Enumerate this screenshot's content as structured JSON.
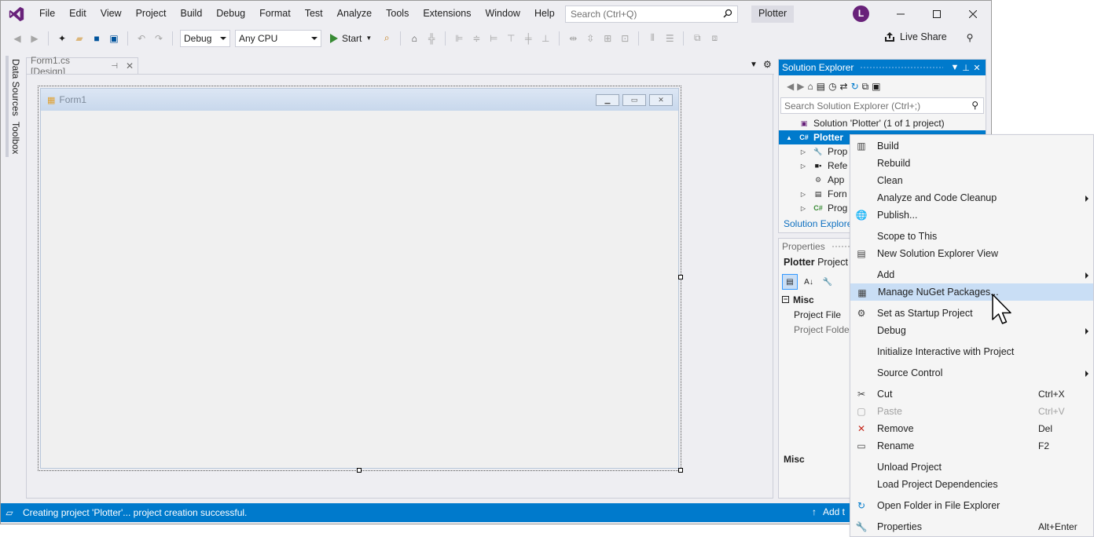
{
  "menubar": {
    "items": [
      "File",
      "Edit",
      "View",
      "Project",
      "Build",
      "Debug",
      "Format",
      "Test",
      "Analyze",
      "Tools",
      "Extensions",
      "Window",
      "Help"
    ],
    "search_placeholder": "Search (Ctrl+Q)",
    "solution_name": "Plotter",
    "avatar_letter": "L"
  },
  "toolbar": {
    "configuration": "Debug",
    "platform": "Any CPU",
    "start_label": "Start",
    "live_share_label": "Live Share"
  },
  "side_tabs": [
    "Data Sources",
    "Toolbox"
  ],
  "document": {
    "tab_label": "Form1.cs [Design]",
    "form_title": "Form1"
  },
  "solution_explorer": {
    "title": "Solution Explorer",
    "search_placeholder": "Search Solution Explorer (Ctrl+;)",
    "tree": [
      {
        "label": "Solution 'Plotter' (1 of 1 project)",
        "icon": "solution-icon",
        "level": 0,
        "expander": ""
      },
      {
        "label": "Plotter",
        "icon": "csharp-project-icon",
        "level": 0,
        "expander": "▲",
        "selected": true
      },
      {
        "label": "Prop",
        "icon": "wrench-icon",
        "level": 1,
        "expander": "▷"
      },
      {
        "label": "Refe",
        "icon": "references-icon",
        "level": 1,
        "expander": "▷"
      },
      {
        "label": "App",
        "icon": "config-file-icon",
        "level": 1,
        "expander": ""
      },
      {
        "label": "Forn",
        "icon": "form-icon",
        "level": 1,
        "expander": "▷"
      },
      {
        "label": "Prog",
        "icon": "csharp-file-icon",
        "level": 1,
        "expander": "▷"
      }
    ],
    "footer_tab": "Solution Explore"
  },
  "properties": {
    "title": "Properties",
    "object_name": "Plotter",
    "object_type": "Project",
    "category": "Misc",
    "rows": [
      "Project File",
      "Project Folder"
    ],
    "description_title": "Misc"
  },
  "statusbar": {
    "message": "Creating project 'Plotter'... project creation successful.",
    "right_text": "Add t"
  },
  "context_menu": {
    "groups": [
      [
        {
          "label": "Build",
          "icon": "build-icon"
        },
        {
          "label": "Rebuild",
          "icon": ""
        },
        {
          "label": "Clean",
          "icon": ""
        },
        {
          "label": "Analyze and Code Cleanup",
          "icon": "",
          "submenu": true
        },
        {
          "label": "Publish...",
          "icon": "globe-icon"
        }
      ],
      [
        {
          "label": "Scope to This",
          "icon": ""
        },
        {
          "label": "New Solution Explorer View",
          "icon": "new-view-icon"
        }
      ],
      [
        {
          "label": "Add",
          "icon": "",
          "submenu": true
        },
        {
          "label": "Manage NuGet Packages...",
          "icon": "nuget-icon",
          "hover": true
        }
      ],
      [
        {
          "label": "Set as Startup Project",
          "icon": "gear-icon"
        },
        {
          "label": "Debug",
          "icon": "",
          "submenu": true
        }
      ],
      [
        {
          "label": "Initialize Interactive with Project",
          "icon": ""
        }
      ],
      [
        {
          "label": "Source Control",
          "icon": "",
          "submenu": true
        }
      ],
      [
        {
          "label": "Cut",
          "icon": "scissors-icon",
          "shortcut": "Ctrl+X"
        },
        {
          "label": "Paste",
          "icon": "clipboard-icon",
          "shortcut": "Ctrl+V",
          "disabled": true
        },
        {
          "label": "Remove",
          "icon": "remove-x-icon",
          "shortcut": "Del"
        },
        {
          "label": "Rename",
          "icon": "rename-icon",
          "shortcut": "F2"
        }
      ],
      [
        {
          "label": "Unload Project",
          "icon": ""
        },
        {
          "label": "Load Project Dependencies",
          "icon": ""
        }
      ],
      [
        {
          "label": "Open Folder in File Explorer",
          "icon": "refresh-arrow-icon"
        }
      ],
      [
        {
          "label": "Properties",
          "icon": "wrench-icon",
          "shortcut": "Alt+Enter"
        }
      ]
    ]
  },
  "colors": {
    "accent": "#007acc",
    "vs_purple": "#68217a",
    "chrome": "#eeeef2",
    "hover": "#c9def5"
  }
}
